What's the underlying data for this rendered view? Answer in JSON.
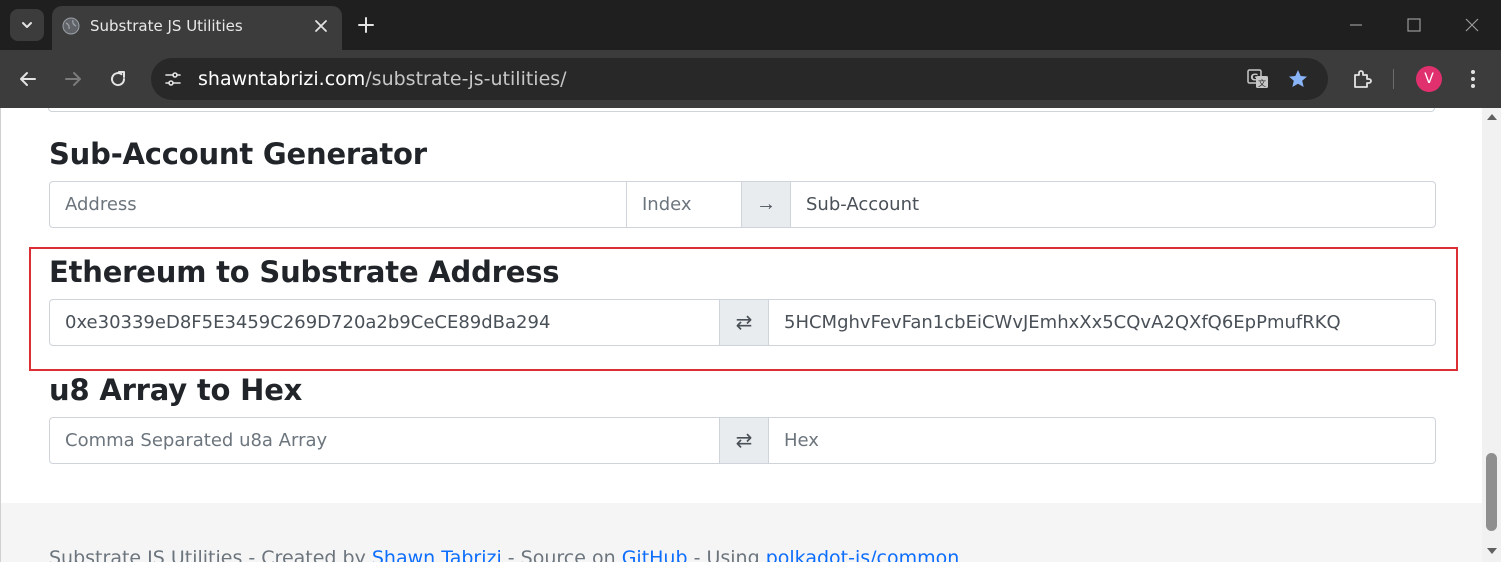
{
  "browser": {
    "tab_title": "Substrate JS Utilities",
    "url_host": "shawntabrizi.com",
    "url_path": "/substrate-js-utilities/",
    "profile_initial": "V"
  },
  "icons": {
    "tab_search": "chevron-down-icon",
    "favicon": "globe-icon",
    "tab_close": "close-icon",
    "new_tab": "plus-icon",
    "back": "arrow-left-icon",
    "forward": "arrow-right-icon",
    "reload": "reload-icon",
    "site_info": "tune-icon",
    "translate": "translate-icon",
    "bookmark": "star-icon",
    "extensions": "puzzle-icon",
    "menu": "kebab-icon"
  },
  "colors": {
    "highlight": "#dc2f34",
    "link": "#0d6efd",
    "avatar": "#e0306e",
    "bookmark_star": "#8ab4f8"
  },
  "sections": {
    "sub_account": {
      "title": "Sub-Account Generator",
      "address_placeholder": "Address",
      "index_placeholder": "Index",
      "arrow": "→",
      "result_placeholder": "Sub-Account"
    },
    "eth_to_substrate": {
      "title": "Ethereum to Substrate Address",
      "eth_value": "0xe30339eD8F5E3459C269D720a2b9CeCE89dBa294",
      "swap": "⇄",
      "substrate_value": "5HCMghvFevFan1cbEiCWvJEmhxXx5CQvA2QXfQ6EpPmufRKQ"
    },
    "u8_to_hex": {
      "title": "u8 Array to Hex",
      "u8_placeholder": "Comma Separated u8a Array",
      "swap": "⇄",
      "hex_placeholder": "Hex"
    }
  },
  "footer": {
    "prefix": "Substrate JS Utilities - Created by ",
    "author": "Shawn Tabrizi",
    "mid1": " - Source on ",
    "source": "GitHub",
    "mid2": " - Using ",
    "lib": "polkadot-js/common"
  }
}
